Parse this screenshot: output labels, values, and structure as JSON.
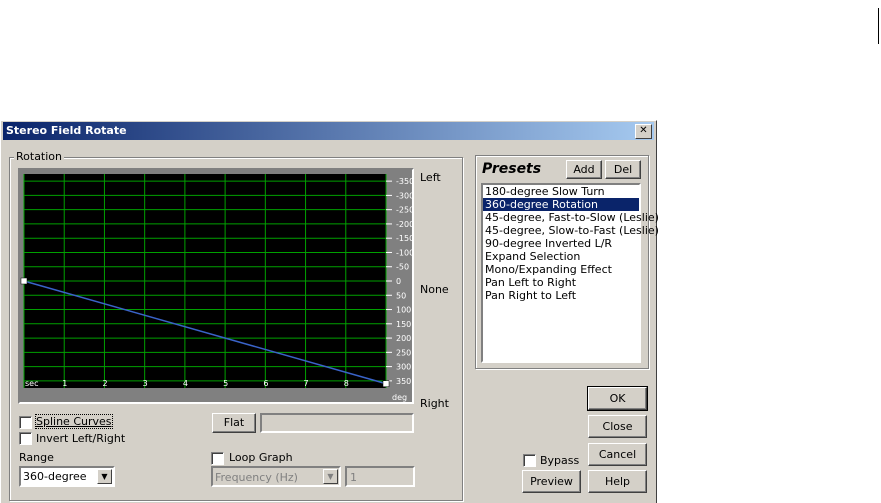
{
  "window": {
    "title": "Stereo Field Rotate",
    "close_glyph": "✕"
  },
  "rotation_group": {
    "label": "Rotation"
  },
  "chart_data": {
    "type": "line",
    "x_unit": "sec",
    "y_unit": "deg",
    "x_ticks": [
      "1",
      "2",
      "3",
      "4",
      "5",
      "6",
      "7",
      "8"
    ],
    "y_ticks": [
      "-350",
      "-300",
      "-250",
      "-200",
      "-150",
      "-100",
      "-50",
      "0",
      "50",
      "100",
      "150",
      "200",
      "250",
      "300",
      "350"
    ],
    "xlim": [
      0,
      9
    ],
    "ylim": [
      -375,
      375
    ],
    "points": [
      [
        0,
        0
      ],
      [
        9,
        360
      ]
    ],
    "grid": true,
    "side_labels": {
      "top": "Left",
      "middle": "None",
      "bottom": "Right"
    }
  },
  "options": {
    "spline_curves": "Spline Curves",
    "invert": "Invert Left/Right",
    "flat_button": "Flat",
    "range_label": "Range",
    "range_value": "360-degree",
    "loop_graph": "Loop Graph",
    "frequency_value": "Frequency (Hz)",
    "frequency_input": "1"
  },
  "presets": {
    "title": "Presets",
    "add": "Add",
    "del": "Del",
    "items": [
      "180-degree Slow Turn",
      "360-degree Rotation",
      "45-degree, Fast-to-Slow (Leslie)",
      "45-degree, Slow-to-Fast (Leslie)",
      "90-degree Inverted L/R",
      "Expand Selection",
      "Mono/Expanding Effect",
      "Pan Left to Right",
      "Pan Right to Left"
    ],
    "selected_index": 1
  },
  "buttons": {
    "ok": "OK",
    "close": "Close",
    "cancel": "Cancel",
    "help": "Help",
    "preview": "Preview",
    "bypass": "Bypass"
  }
}
